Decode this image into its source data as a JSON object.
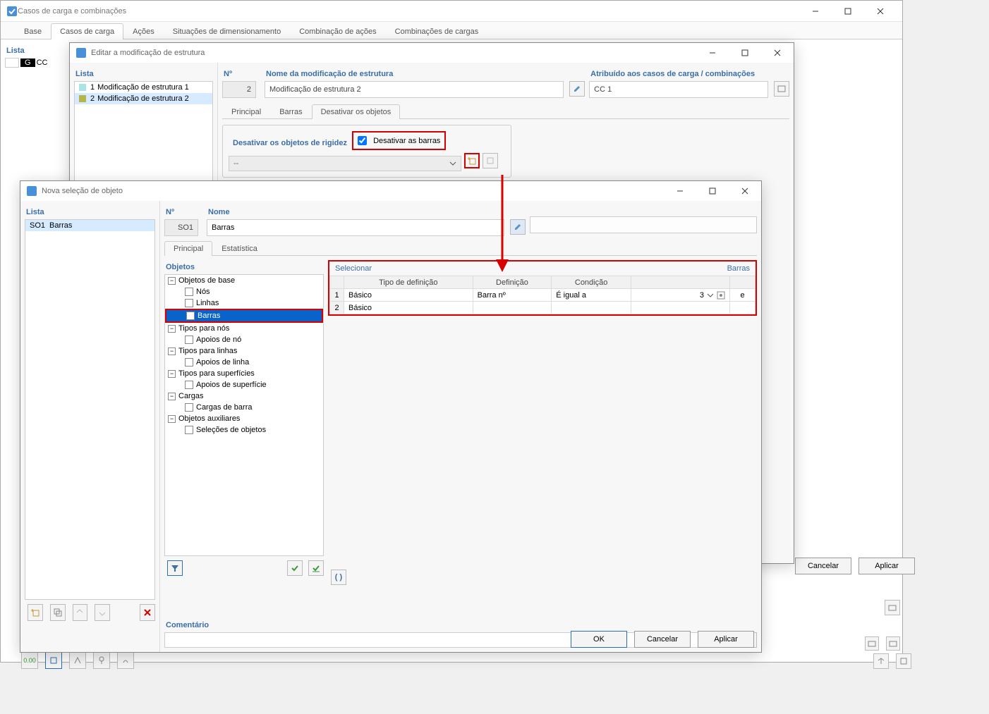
{
  "main": {
    "title": "Casos de carga e combinações",
    "tabs": [
      "Base",
      "Casos de carga",
      "Ações",
      "Situações de dimensionamento",
      "Combinação de ações",
      "Combinações de cargas"
    ],
    "active_tab": 1,
    "side_list": {
      "header": "Lista",
      "badge": "G",
      "extra": "CC"
    }
  },
  "edit": {
    "title": "Editar a modificação de estrutura",
    "list_header": "Lista",
    "list": [
      {
        "num": "1",
        "label": "Modificação de estrutura 1",
        "color": "#a8e6e6"
      },
      {
        "num": "2",
        "label": "Modificação de estrutura 2",
        "color": "#b5b54a"
      }
    ],
    "fields": {
      "no_label": "Nº",
      "no_value": "2",
      "name_label": "Nome da modificação de estrutura",
      "name_value": "Modificação de estrutura 2",
      "assigned_label": "Atribuído aos casos de carga / combinações",
      "assigned_value": "CC 1"
    },
    "tabs": [
      "Principal",
      "Barras",
      "Desativar os objetos"
    ],
    "active_tab": 2,
    "group_title": "Desativar os objetos de rigidez",
    "checkbox_label": "Desativar as barras",
    "combo_value": "--"
  },
  "sel": {
    "title": "Nova seleção de objeto",
    "list_header": "Lista",
    "list": [
      {
        "id": "SO1",
        "label": "Barras"
      }
    ],
    "no_label": "Nº",
    "no_value": "SO1",
    "name_label": "Nome",
    "name_value": "Barras",
    "tabs": [
      "Principal",
      "Estatística"
    ],
    "active_tab": 0,
    "objects_label": "Objetos",
    "tree": [
      {
        "type": "group",
        "label": "Objetos de base",
        "expanded": true
      },
      {
        "type": "item",
        "label": "Nós",
        "checked": false
      },
      {
        "type": "item",
        "label": "Linhas",
        "checked": false
      },
      {
        "type": "item",
        "label": "Barras",
        "checked": true,
        "selected": true,
        "highlight": true
      },
      {
        "type": "group",
        "label": "Tipos para nós",
        "expanded": true
      },
      {
        "type": "item",
        "label": "Apoios de nó",
        "checked": false
      },
      {
        "type": "group",
        "label": "Tipos para linhas",
        "expanded": true
      },
      {
        "type": "item",
        "label": "Apoios de linha",
        "checked": false
      },
      {
        "type": "group",
        "label": "Tipos para superfícies",
        "expanded": true
      },
      {
        "type": "item",
        "label": "Apoios de superfície",
        "checked": false
      },
      {
        "type": "group",
        "label": "Cargas",
        "expanded": true
      },
      {
        "type": "item",
        "label": "Cargas de barra",
        "checked": false
      },
      {
        "type": "group",
        "label": "Objetos auxiliares",
        "expanded": true
      },
      {
        "type": "item",
        "label": "Seleções de objetos",
        "checked": false
      }
    ],
    "select_title": "Selecionar",
    "select_right": "Barras",
    "columns": [
      "",
      "Tipo de definição",
      "Definição",
      "Condição",
      "",
      ""
    ],
    "rows": [
      {
        "n": "1",
        "type": "Básico",
        "def": "Barra nº",
        "cond": "É igual a",
        "val": "3",
        "op": "e"
      },
      {
        "n": "2",
        "type": "Básico",
        "def": "",
        "cond": "",
        "val": "",
        "op": ""
      }
    ],
    "comment_label": "Comentário",
    "buttons": {
      "ok": "OK",
      "cancel": "Cancelar",
      "apply": "Aplicar"
    }
  },
  "bg_buttons": {
    "cancel": "Cancelar",
    "apply": "Aplicar"
  }
}
